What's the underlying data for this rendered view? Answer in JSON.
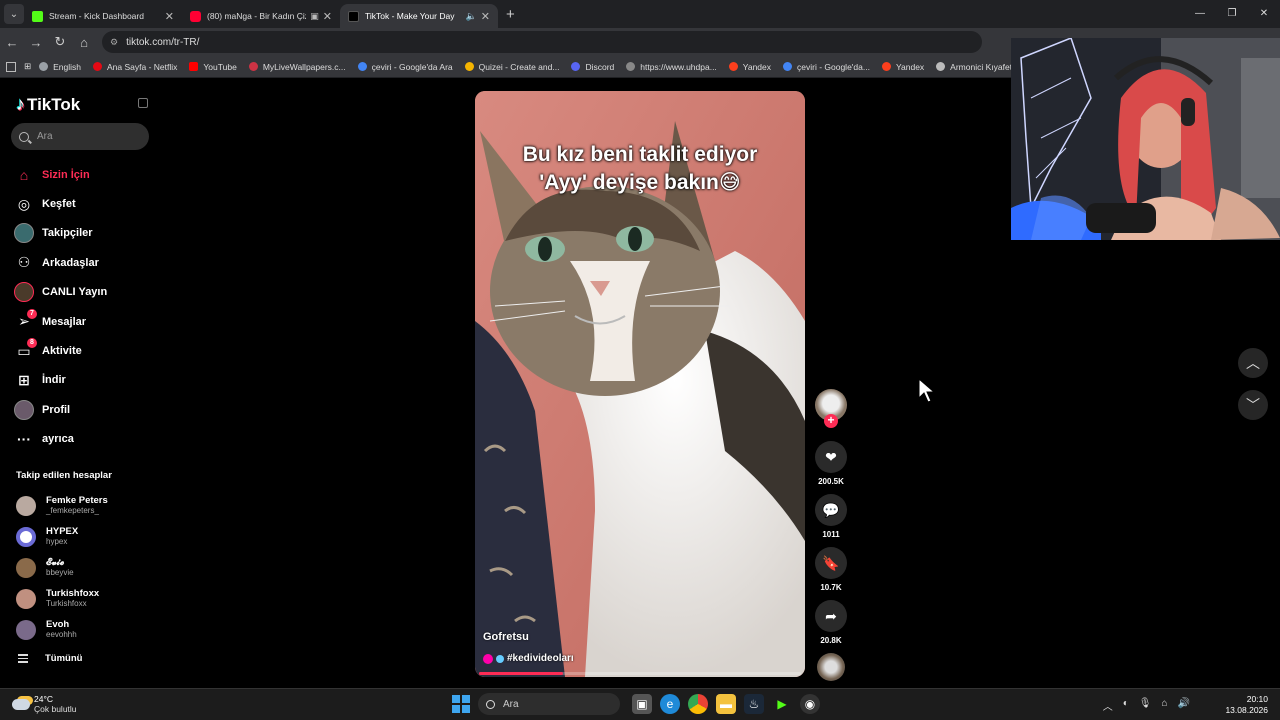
{
  "browser": {
    "tabs": [
      {
        "title": "Stream - Kick Dashboard",
        "color": "#53fc18",
        "active": false
      },
      {
        "title": "(80) maNga - Bir Kadın Çiz",
        "color": "#ff0033",
        "active": false
      },
      {
        "title": "TikTok - Make Your Day",
        "color": "#000000",
        "active": true
      }
    ],
    "url": "tiktok.com/tr-TR/",
    "bookmarks": [
      {
        "label": "English",
        "color": "#9aa0a6"
      },
      {
        "label": "Ana Sayfa - Netflix",
        "color": "#e50914"
      },
      {
        "label": "YouTube",
        "color": "#ff0000"
      },
      {
        "label": "MyLiveWallpapers.c...",
        "color": "#cc3344"
      },
      {
        "label": "çeviri - Google'da Ara",
        "color": "#4285f4"
      },
      {
        "label": "Quizei - Create and...",
        "color": "#f5b400"
      },
      {
        "label": "Discord",
        "color": "#5865f2"
      },
      {
        "label": "https://www.uhdpa...",
        "color": "#888888"
      },
      {
        "label": "Yandex",
        "color": "#fc3f1d"
      },
      {
        "label": "çeviri - Google'da...",
        "color": "#4285f4"
      },
      {
        "label": "Yandex",
        "color": "#fc3f1d"
      },
      {
        "label": "Armonici Kıyafet - F...",
        "color": "#bbbbbb"
      }
    ]
  },
  "tiktok": {
    "logo": "TikTok",
    "search_placeholder": "Ara",
    "menu": [
      {
        "label": "Sizin İçin",
        "icon": "home-icon",
        "glyph": "⌂",
        "active": true
      },
      {
        "label": "Keşfet",
        "icon": "compass-icon",
        "glyph": "◎"
      },
      {
        "label": "Takipçiler",
        "icon": "followers-avatar-icon",
        "glyph": ""
      },
      {
        "label": "Arkadaşlar",
        "icon": "friends-icon",
        "glyph": "⚇"
      },
      {
        "label": "CANLI Yayın",
        "icon": "live-avatar-icon",
        "glyph": ""
      },
      {
        "label": "Mesajlar",
        "icon": "messages-icon",
        "glyph": "➢",
        "badge": "7"
      },
      {
        "label": "Aktivite",
        "icon": "activity-icon",
        "glyph": "▭",
        "badge": "8"
      },
      {
        "label": "İndir",
        "icon": "download-icon",
        "glyph": "⊞"
      },
      {
        "label": "Profil",
        "icon": "profile-avatar-icon",
        "glyph": ""
      },
      {
        "label": "ayrıca",
        "icon": "more-icon",
        "glyph": "···"
      }
    ],
    "following_title": "Takip edilen hesaplar",
    "following": [
      {
        "name": "Femke Peters",
        "handle": "_femkepeters_",
        "color": "#b9a9a0"
      },
      {
        "name": "HYPEX",
        "handle": "hypex",
        "color": "#6b6bd6"
      },
      {
        "name": "𝓔𝓿𝓲𝓮",
        "handle": "bbeyvie",
        "color": "#8a6a4a"
      },
      {
        "name": "Turkishfoxx",
        "handle": "Turkishfoxx",
        "color": "#c09080"
      },
      {
        "name": "Evoh",
        "handle": "eevohhh",
        "color": "#7a6a8a"
      }
    ],
    "see_all": "Tümünü",
    "video": {
      "caption_line1": "Bu kız beni taklit ediyor",
      "caption_line2": "'Ayy' deyişe bakın😅",
      "author": "Gofretsu",
      "hashtag": "#kedivideoları",
      "progress": 0.26
    },
    "actions": {
      "likes": "200.5K",
      "comments": "1011",
      "saves": "10.7K",
      "shares": "20.8K"
    }
  },
  "taskbar": {
    "temp": "24°C",
    "weather": "Çok bulutlu",
    "search": "Ara",
    "time": "20:10",
    "date": "13.08.2026"
  }
}
